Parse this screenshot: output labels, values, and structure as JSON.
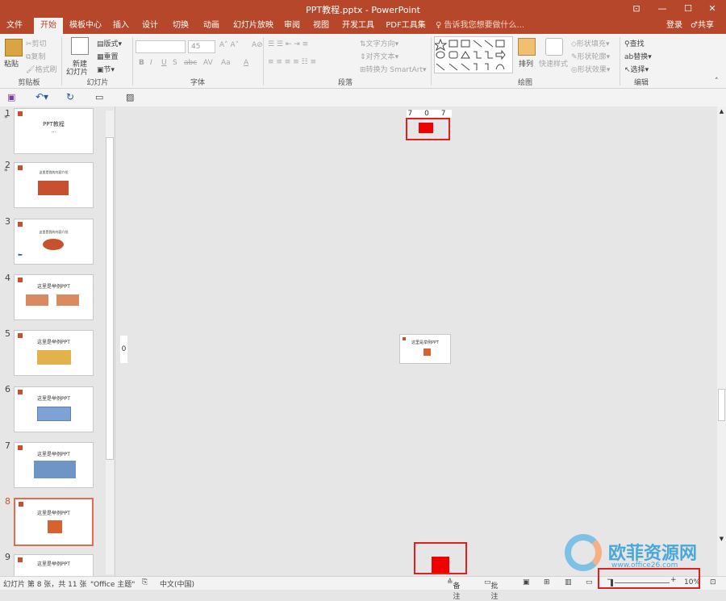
{
  "window": {
    "title": "PPT教程.pptx - PowerPoint",
    "controls": [
      "⊡",
      "—",
      "☐",
      "✕"
    ]
  },
  "tabs": [
    "文件",
    "开始",
    "模板中心",
    "插入",
    "设计",
    "切换",
    "动画",
    "幻灯片放映",
    "审阅",
    "视图",
    "开发工具",
    "PDF工具集"
  ],
  "tellme": "告诉我您想要做什么...",
  "account": {
    "login": "登录",
    "share": "共享"
  },
  "ribbon": {
    "clipboard": {
      "label": "剪贴板",
      "paste": "粘贴",
      "cut": "剪切",
      "copy": "复制",
      "format_painter": "格式刷"
    },
    "slides": {
      "label": "幻灯片",
      "new_slide": "新建",
      "new_slide2": "幻灯片",
      "layout": "版式",
      "reset": "重置",
      "section": "节"
    },
    "font": {
      "label": "字体",
      "size": "45",
      "bold": "B",
      "italic": "I",
      "underline": "U",
      "shadow": "S",
      "strike": "abc",
      "spacing": "AV",
      "case": "Aa",
      "color": "A"
    },
    "paragraph": {
      "label": "段落",
      "text_direction": "文字方向",
      "align_text": "对齐文本",
      "smartart": "转换为 SmartArt"
    },
    "drawing": {
      "label": "绘图",
      "arrange": "排列",
      "quick_styles": "快速样式",
      "fill": "形状填充",
      "outline": "形状轮廓",
      "effects": "形状效果"
    },
    "editing": {
      "label": "编辑",
      "find": "查找",
      "replace": "替换",
      "select": "选择"
    }
  },
  "slides": [
    {
      "num": "1",
      "star": "*",
      "title": "PPT教程",
      "sub": "..."
    },
    {
      "num": "2",
      "star": "*",
      "title": "这里是我的内容介绍"
    },
    {
      "num": "3",
      "title": "这里是我的内容介绍"
    },
    {
      "num": "4",
      "title": "这里是举例PPT"
    },
    {
      "num": "5",
      "title": "这里是举例PPT"
    },
    {
      "num": "6",
      "title": "这里是举例PPT"
    },
    {
      "num": "7",
      "title": "这里是举例PPT"
    },
    {
      "num": "8",
      "title": "这里是举例PPT"
    },
    {
      "num": "9",
      "title": "这里是举例PPT"
    }
  ],
  "selected_slide": "8",
  "canvas": {
    "ruler_top": "7 0 7",
    "ruler_left": "0",
    "mini_title": "这里是举例PPT"
  },
  "status": {
    "slide_info": "幻灯片 第 8 张，共 11 张",
    "theme": "\"Office 主题\"",
    "language": "中文(中国)",
    "notes": "备注",
    "comments": "批注",
    "zoom": "10%"
  },
  "watermark": {
    "text": "欧菲资源网",
    "url": "www.office26.com"
  },
  "colors": {
    "accent": "#b7472a",
    "highlight": "#e02020",
    "fill": "#f00000"
  }
}
